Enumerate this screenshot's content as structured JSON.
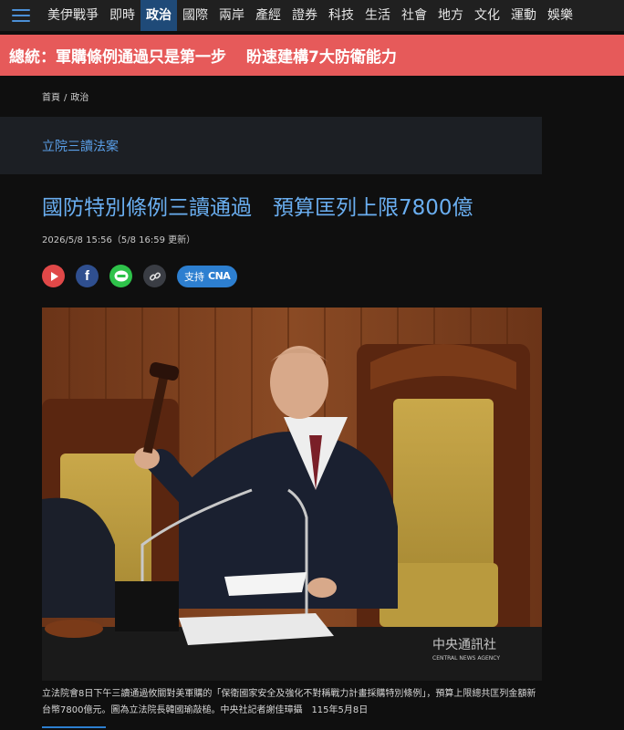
{
  "nav": {
    "items": [
      "美伊戰爭",
      "即時",
      "政治",
      "國際",
      "兩岸",
      "產經",
      "證券",
      "科技",
      "生活",
      "社會",
      "地方",
      "文化",
      "運動",
      "娛樂"
    ],
    "active_index": 2
  },
  "breaking": {
    "speaker": "總統：",
    "text1": "軍購條例通過只是第一步",
    "text2": "盼速建構7大防衛能力"
  },
  "breadcrumb": {
    "home": "首頁",
    "sep": "/",
    "section": "政治"
  },
  "category": {
    "label": "立院三讀法案"
  },
  "article": {
    "headline": "國防特別條例三讀通過　預算匡列上限7800億",
    "dateline": "2026/5/8 15:56（5/8 16:59 更新）"
  },
  "share": {
    "support_label": "支持",
    "support_brand": "CNA"
  },
  "photo": {
    "watermark_cn": "中央通訊社",
    "watermark_en": "CENTRAL NEWS AGENCY"
  },
  "caption": {
    "text": "立法院會8日下午三讀通過攸關對美軍購的「保衛國家安全及強化不對稱戰力計畫採購特別條例」，預算上限總共匡列金額新台幣7800億元。圖為立法院長韓國瑜敲槌。中央社記者謝佳璋攝　115年5月8日"
  },
  "colors": {
    "accent": "#6aaef0",
    "breaking_bg": "#e65a5a",
    "nav_active": "#1f4a78"
  }
}
